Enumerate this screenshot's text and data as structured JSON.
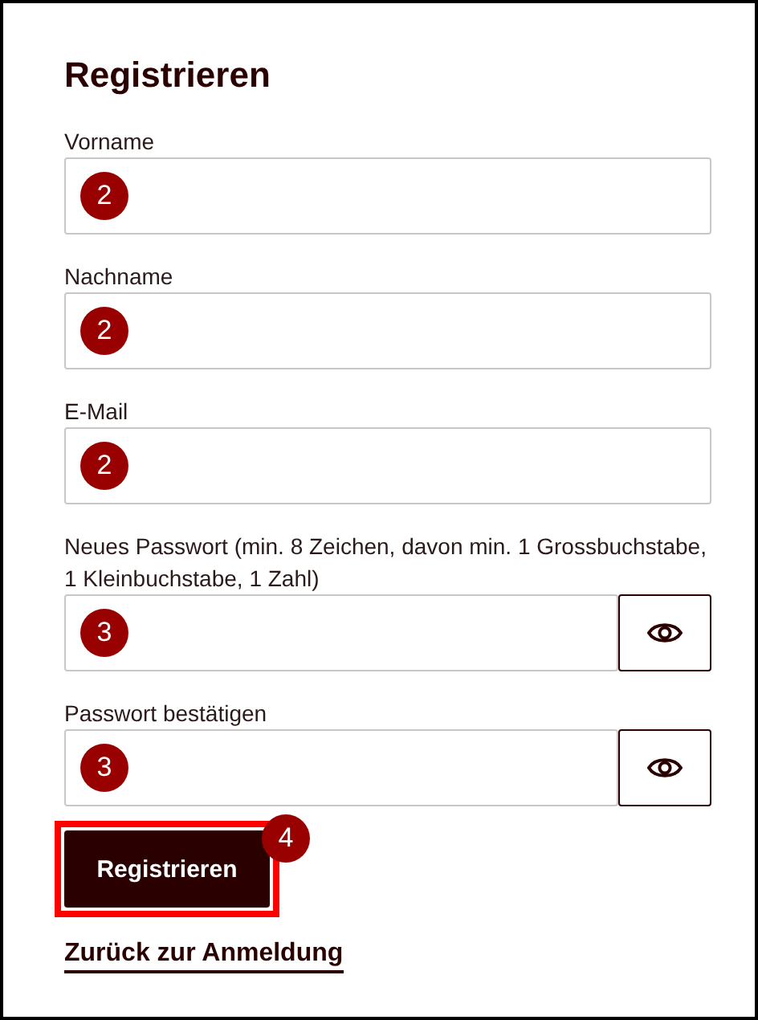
{
  "title": "Registrieren",
  "fields": [
    {
      "label": "Vorname",
      "kind": "text",
      "badge": "2"
    },
    {
      "label": "Nachname",
      "kind": "text",
      "badge": "2"
    },
    {
      "label": "E-Mail",
      "kind": "text",
      "badge": "2"
    },
    {
      "label": "Neues Passwort (min. 8 Zeichen, davon min. 1 Grossbuchstabe, 1 Kleinbuchstabe, 1 Zahl)",
      "kind": "password",
      "badge": "3"
    },
    {
      "label": "Passwort bestätigen",
      "kind": "password",
      "badge": "3"
    }
  ],
  "submit": {
    "label": "Registrieren",
    "highlighted": true,
    "badge": "4"
  },
  "back_link": "Zurück zur Anmeldung"
}
